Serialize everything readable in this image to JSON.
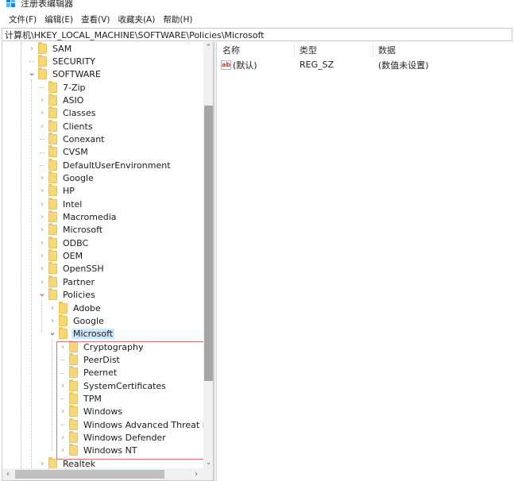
{
  "window": {
    "title": "注册表编辑器",
    "icon": "regedit-icon"
  },
  "menubar": {
    "items": [
      "文件(F)",
      "编辑(E)",
      "查看(V)",
      "收藏夹(A)",
      "帮助(H)"
    ]
  },
  "address": {
    "path": "计算机\\HKEY_LOCAL_MACHINE\\SOFTWARE\\Policies\\Microsoft"
  },
  "tree": {
    "nodes": [
      {
        "label": "SAM",
        "level": 0,
        "expander": "collapsed"
      },
      {
        "label": "SECURITY",
        "level": 0,
        "expander": "none"
      },
      {
        "label": "SOFTWARE",
        "level": 0,
        "expander": "expanded"
      },
      {
        "label": "7-Zip",
        "level": 1,
        "expander": "none"
      },
      {
        "label": "ASIO",
        "level": 1,
        "expander": "collapsed"
      },
      {
        "label": "Classes",
        "level": 1,
        "expander": "collapsed"
      },
      {
        "label": "Clients",
        "level": 1,
        "expander": "collapsed"
      },
      {
        "label": "Conexant",
        "level": 1,
        "expander": "none"
      },
      {
        "label": "CVSM",
        "level": 1,
        "expander": "none"
      },
      {
        "label": "DefaultUserEnvironment",
        "level": 1,
        "expander": "none"
      },
      {
        "label": "Google",
        "level": 1,
        "expander": "collapsed"
      },
      {
        "label": "HP",
        "level": 1,
        "expander": "collapsed"
      },
      {
        "label": "Intel",
        "level": 1,
        "expander": "collapsed"
      },
      {
        "label": "Macromedia",
        "level": 1,
        "expander": "collapsed"
      },
      {
        "label": "Microsoft",
        "level": 1,
        "expander": "collapsed"
      },
      {
        "label": "ODBC",
        "level": 1,
        "expander": "collapsed"
      },
      {
        "label": "OEM",
        "level": 1,
        "expander": "collapsed"
      },
      {
        "label": "OpenSSH",
        "level": 1,
        "expander": "collapsed"
      },
      {
        "label": "Partner",
        "level": 1,
        "expander": "collapsed"
      },
      {
        "label": "Policies",
        "level": 1,
        "expander": "expanded"
      },
      {
        "label": "Adobe",
        "level": 2,
        "expander": "collapsed"
      },
      {
        "label": "Google",
        "level": 2,
        "expander": "collapsed"
      },
      {
        "label": "Microsoft",
        "level": 2,
        "expander": "expanded",
        "selected": true
      },
      {
        "label": "Cryptography",
        "level": 3,
        "expander": "collapsed"
      },
      {
        "label": "PeerDist",
        "level": 3,
        "expander": "none"
      },
      {
        "label": "Peernet",
        "level": 3,
        "expander": "none"
      },
      {
        "label": "SystemCertificates",
        "level": 3,
        "expander": "collapsed"
      },
      {
        "label": "TPM",
        "level": 3,
        "expander": "none"
      },
      {
        "label": "Windows",
        "level": 3,
        "expander": "collapsed"
      },
      {
        "label": "Windows Advanced Threat Protection",
        "level": 3,
        "expander": "none"
      },
      {
        "label": "Windows Defender",
        "level": 3,
        "expander": "collapsed"
      },
      {
        "label": "Windows NT",
        "level": 3,
        "expander": "collapsed"
      },
      {
        "label": "Realtek",
        "level": 1,
        "expander": "collapsed"
      }
    ],
    "highlight_note": "red box around Microsoft subkeys"
  },
  "scroll": {
    "vertical_position_fraction": 0.17,
    "vertical_visible_fraction": 0.68
  },
  "values": {
    "columns": [
      "名称",
      "类型",
      "数据"
    ],
    "rows": [
      {
        "name": "(默认)",
        "type": "REG_SZ",
        "data": "(数值未设置)",
        "icon": "string-value-icon"
      }
    ]
  },
  "colors": {
    "selection": "#cce8ff",
    "highlight_box": "#e0707a",
    "folder": "#f8d775"
  }
}
